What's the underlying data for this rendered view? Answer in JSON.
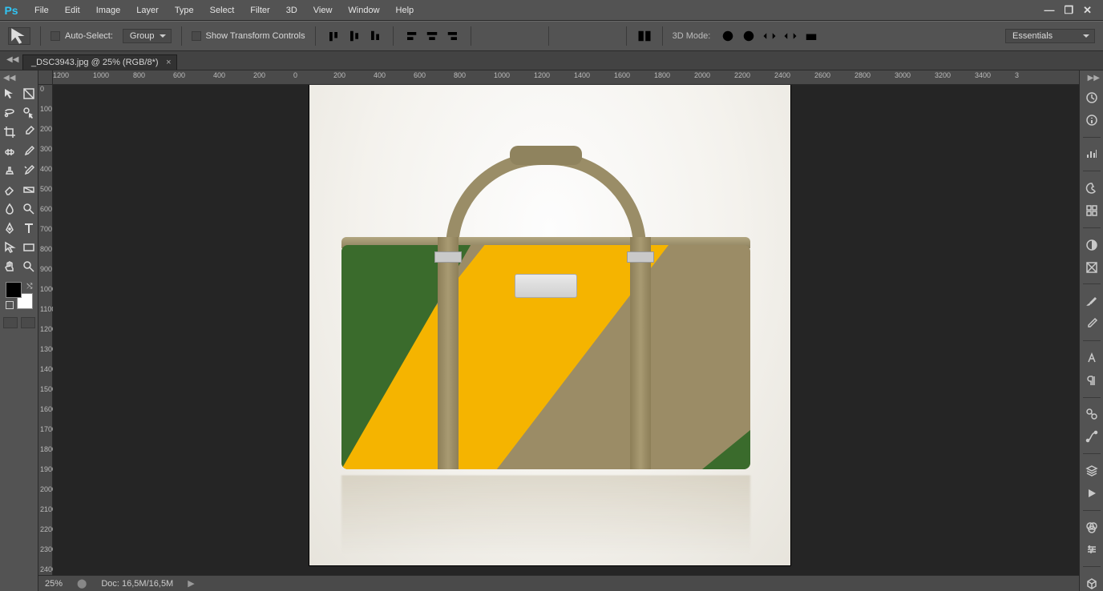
{
  "app": {
    "logo_text": "Ps"
  },
  "menu": [
    "File",
    "Edit",
    "Image",
    "Layer",
    "Type",
    "Select",
    "Filter",
    "3D",
    "View",
    "Window",
    "Help"
  ],
  "window_controls": {
    "min": "—",
    "max": "❐",
    "close": "✕"
  },
  "options": {
    "auto_select_label": "Auto-Select:",
    "auto_select_value": "Group",
    "show_transform_label": "Show Transform Controls",
    "mode3d_label": "3D Mode:",
    "workspace_value": "Essentials"
  },
  "document": {
    "tab_label": "_DSC3943.jpg @ 25% (RGB/8*)",
    "zoom": "25%",
    "doc_size": "Doc: 16,5M/16,5M"
  },
  "ruler_h": [
    "1200",
    "1000",
    "800",
    "600",
    "400",
    "200",
    "0",
    "200",
    "400",
    "600",
    "800",
    "1000",
    "1200",
    "1400",
    "1600",
    "1800",
    "2000",
    "2200",
    "2400",
    "2600",
    "2800",
    "3000",
    "3200",
    "3400",
    "3"
  ],
  "ruler_v": [
    "0",
    "100",
    "200",
    "300",
    "400",
    "500",
    "600",
    "700",
    "800",
    "900",
    "1000",
    "1100",
    "1200",
    "1300",
    "1400",
    "1500",
    "1600",
    "1700",
    "1800",
    "1900",
    "2000",
    "2100",
    "2200",
    "2300",
    "2400"
  ],
  "swatch": {
    "fg": "#000000",
    "bg": "#ffffff"
  },
  "status_globe": "⬤"
}
